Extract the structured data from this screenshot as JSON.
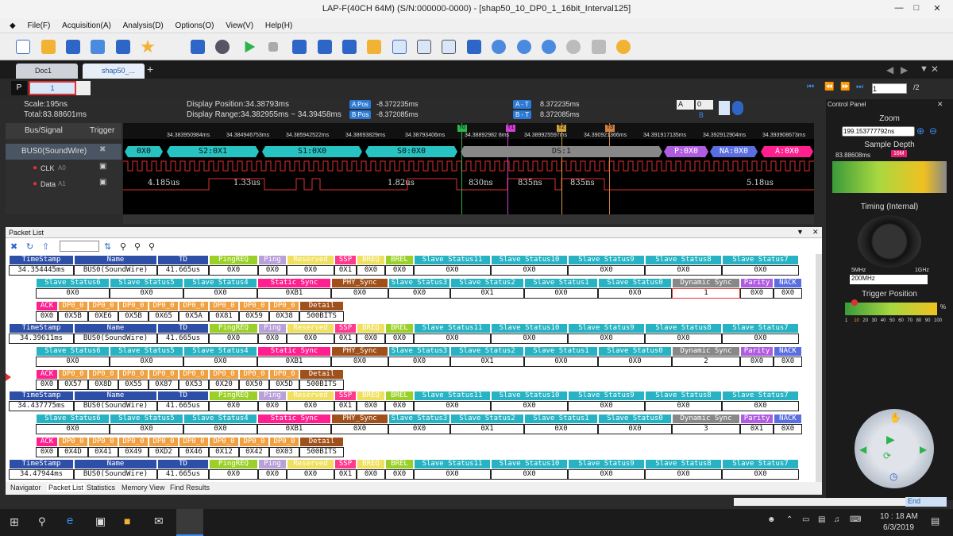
{
  "window": {
    "title": "LAP-F(40CH 64M) (S/N:000000-0000) - [shap50_10_DP0_1_16bit_Interval125]"
  },
  "menu": [
    "File(F)",
    "Acquisition(A)",
    "Analysis(D)",
    "Options(O)",
    "View(V)",
    "Help(H)"
  ],
  "tabs": [
    {
      "label": "Doc1"
    },
    {
      "label": "shap50_..."
    }
  ],
  "nav": {
    "page_value": "1",
    "page_total": "/2",
    "play_label": "1"
  },
  "info": {
    "scale": "Scale:195ns",
    "total": "Total:83.88601ms",
    "display_position": "Display Position:34.38793ms",
    "display_range": "Display Range:34.382955ms ~ 34.39458ms",
    "a_pos_label": "A Pos",
    "a_pos": "-8.372235ms",
    "b_pos_label": "B Pos",
    "b_pos": "-8.372085ms",
    "a_t_label": "A - T",
    "a_t": "8.372235ms",
    "b_t_label": "B - T",
    "b_t": "8.372085ms",
    "sel_a": "A",
    "sel_0": "0",
    "sel_b": "B"
  },
  "signals": {
    "header_bus": "Bus/Signal",
    "header_trigger": "Trigger",
    "bus": "BUS0(SoundWire)",
    "clk": "CLK",
    "clk_ch": "A0",
    "data": "Data",
    "data_ch": "A1"
  },
  "ticks": [
    "34.383950984ms",
    "34.384946753ms",
    "34.385942522ms",
    "34.38693829ms",
    "34.38793406ms",
    "34.38892982 8ms",
    "34.389925597ms",
    "34.390921366ms",
    "34.391917135ms",
    "34.392912904ms",
    "34.393908673ms"
  ],
  "markers": [
    "T0",
    "T1",
    "T2",
    "T3"
  ],
  "segments": [
    {
      "text": "0X0",
      "color": "#27c3c3"
    },
    {
      "text": "S2:0X1",
      "color": "#27c3c3"
    },
    {
      "text": "S1:0X0",
      "color": "#27c3c3"
    },
    {
      "text": "S0:0X0",
      "color": "#27c3c3"
    },
    {
      "text": "DS:1",
      "color": "#888888"
    },
    {
      "text": "P:0X0",
      "color": "#b05ce0"
    },
    {
      "text": "NA:0X0",
      "color": "#5a6ee0"
    },
    {
      "text": "A:0X0",
      "color": "#ff1f8e"
    }
  ],
  "durations": [
    "4.185us",
    "1.33us",
    "1.82us",
    "830ns",
    "835ns",
    "835ns",
    "5.18us"
  ],
  "control_panel": {
    "title": "Control Panel",
    "zoom": "Zoom",
    "zoom_value": "199.153777792ns",
    "sample_depth": "Sample Depth",
    "sample_value": "83.88608ms",
    "sample_badge": "16M",
    "timing": "Timing (Internal)",
    "freq_min": "5MHz",
    "freq_max": "1GHz",
    "freq_value": "200MHz",
    "trigger_position": "Trigger Position",
    "trigger_scale": [
      "1",
      "10",
      "20",
      "30",
      "40",
      "50",
      "60",
      "70",
      "80",
      "90",
      "100"
    ],
    "percent": "%"
  },
  "packet_list": {
    "title": "Packet List",
    "headers_row1": [
      "TimeStamp",
      "Name",
      "TD",
      "PingREQ",
      "Ping",
      "Reserved",
      "SSP",
      "BREQ",
      "BREL",
      "Slave Status11",
      "Slave Status10",
      "Slave Status9",
      "Slave Status8",
      "Slave Status7"
    ],
    "headers_row2": [
      "Slave Status6",
      "Slave Status5",
      "Slave Status4",
      "Static Sync",
      "PHY_Sync",
      "Slave Status3",
      "Slave Status2",
      "Slave Status1",
      "Slave Status0",
      "Dynamic Sync",
      "Parity",
      "NACK"
    ],
    "headers_row3": [
      "ACK",
      "DP0_0",
      "DP0_0",
      "DP0_0",
      "DP0_0",
      "DP0_0",
      "DP0_0",
      "DP0_0",
      "DP0_0",
      "Detail"
    ],
    "packets": [
      {
        "r1": [
          "34.354445ms",
          "BUS0(SoundWire)",
          "41.665us",
          "0X0",
          "0X0",
          "0X0",
          "0X1",
          "0X0",
          "0X0",
          "0X0",
          "0X0",
          "0X0",
          "0X0",
          "0X0"
        ],
        "r2": [
          "0X0",
          "0X0",
          "0X0",
          "0XB1",
          "0X0",
          "0X0",
          "0X1",
          "0X0",
          "0X0",
          "1",
          "0X0",
          "0X0"
        ],
        "r3": [
          "0X0",
          "0X5B",
          "0XE6",
          "0X5B",
          "0X65",
          "0X5A",
          "0X81",
          "0X59",
          "0X38",
          "500BITS"
        ]
      },
      {
        "r1": [
          "34.39611ms",
          "BUS0(SoundWire)",
          "41.665us",
          "0X0",
          "0X0",
          "0X0",
          "0X1",
          "0X0",
          "0X0",
          "0X0",
          "0X0",
          "0X0",
          "0X0",
          "0X0"
        ],
        "r2": [
          "0X0",
          "0X0",
          "0X0",
          "0XB1",
          "0X0",
          "0X0",
          "0X1",
          "0X0",
          "0X0",
          "2",
          "0X0",
          "0X0"
        ],
        "r3": [
          "0X0",
          "0X57",
          "0X8D",
          "0X55",
          "0X87",
          "0X53",
          "0X20",
          "0X50",
          "0X5D",
          "500BITS"
        ]
      },
      {
        "r1": [
          "34.437775ms",
          "BUS0(SoundWire)",
          "41.665us",
          "0X0",
          "0X0",
          "0X0",
          "0X1",
          "0X0",
          "0X0",
          "0X0",
          "0X0",
          "0X0",
          "0X0",
          "0X0"
        ],
        "r2": [
          "0X0",
          "0X0",
          "0X0",
          "0XB1",
          "0X0",
          "0X0",
          "0X1",
          "0X0",
          "0X0",
          "3",
          "0X1",
          "0X0"
        ],
        "r3": [
          "0X0",
          "0X4D",
          "0X41",
          "0X49",
          "0XD2",
          "0X46",
          "0X12",
          "0X42",
          "0X03",
          "500BITS"
        ]
      },
      {
        "r1": [
          "34.47944ms",
          "BUS0(SoundWire)",
          "41.665us",
          "0X0",
          "0X0",
          "0X0",
          "0X1",
          "0X0",
          "0X0",
          "0X0",
          "0X0",
          "0X0",
          "0X0",
          "0X0"
        ]
      }
    ]
  },
  "bottom_tabs": [
    "Navigator",
    "Packet List",
    "Statistics",
    "Memory View",
    "Find Results"
  ],
  "status": {
    "end": "End"
  },
  "taskbar": {
    "time": "10 : 18 AM",
    "date": "6/3/2019"
  }
}
